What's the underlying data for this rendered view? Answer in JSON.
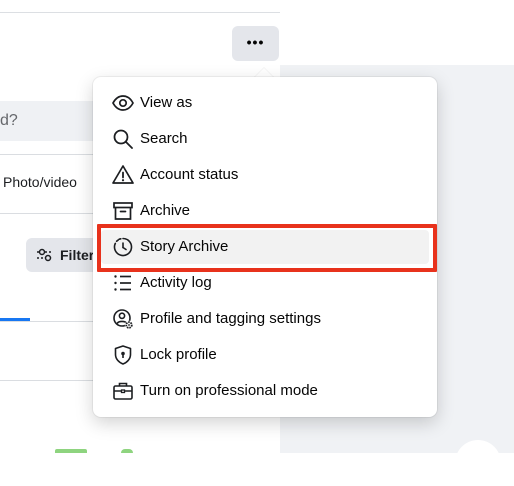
{
  "colors": {
    "highlight_border": "#e8321c",
    "tab_active": "#1877f2",
    "button_bg": "#e4e6eb",
    "page_bg": "#f0f2f5"
  },
  "more_button": {
    "label": "•••",
    "icon": "more-horizontal-icon"
  },
  "composer": {
    "input_placeholder": "d?",
    "photo_video_label": "Photo/video"
  },
  "filters_button": {
    "label": "Filter",
    "icon": "sliders-icon"
  },
  "menu": {
    "items": [
      {
        "label": "View as",
        "icon": "eye-icon"
      },
      {
        "label": "Search",
        "icon": "search-icon"
      },
      {
        "label": "Account status",
        "icon": "warning-triangle-icon"
      },
      {
        "label": "Archive",
        "icon": "archive-box-icon"
      },
      {
        "label": "Story Archive",
        "icon": "story-clock-icon",
        "highlighted": true
      },
      {
        "label": "Activity log",
        "icon": "list-icon"
      },
      {
        "label": "Profile and tagging settings",
        "icon": "user-gear-icon"
      },
      {
        "label": "Lock profile",
        "icon": "shield-lock-icon"
      },
      {
        "label": "Turn on professional mode",
        "icon": "briefcase-icon"
      }
    ]
  }
}
